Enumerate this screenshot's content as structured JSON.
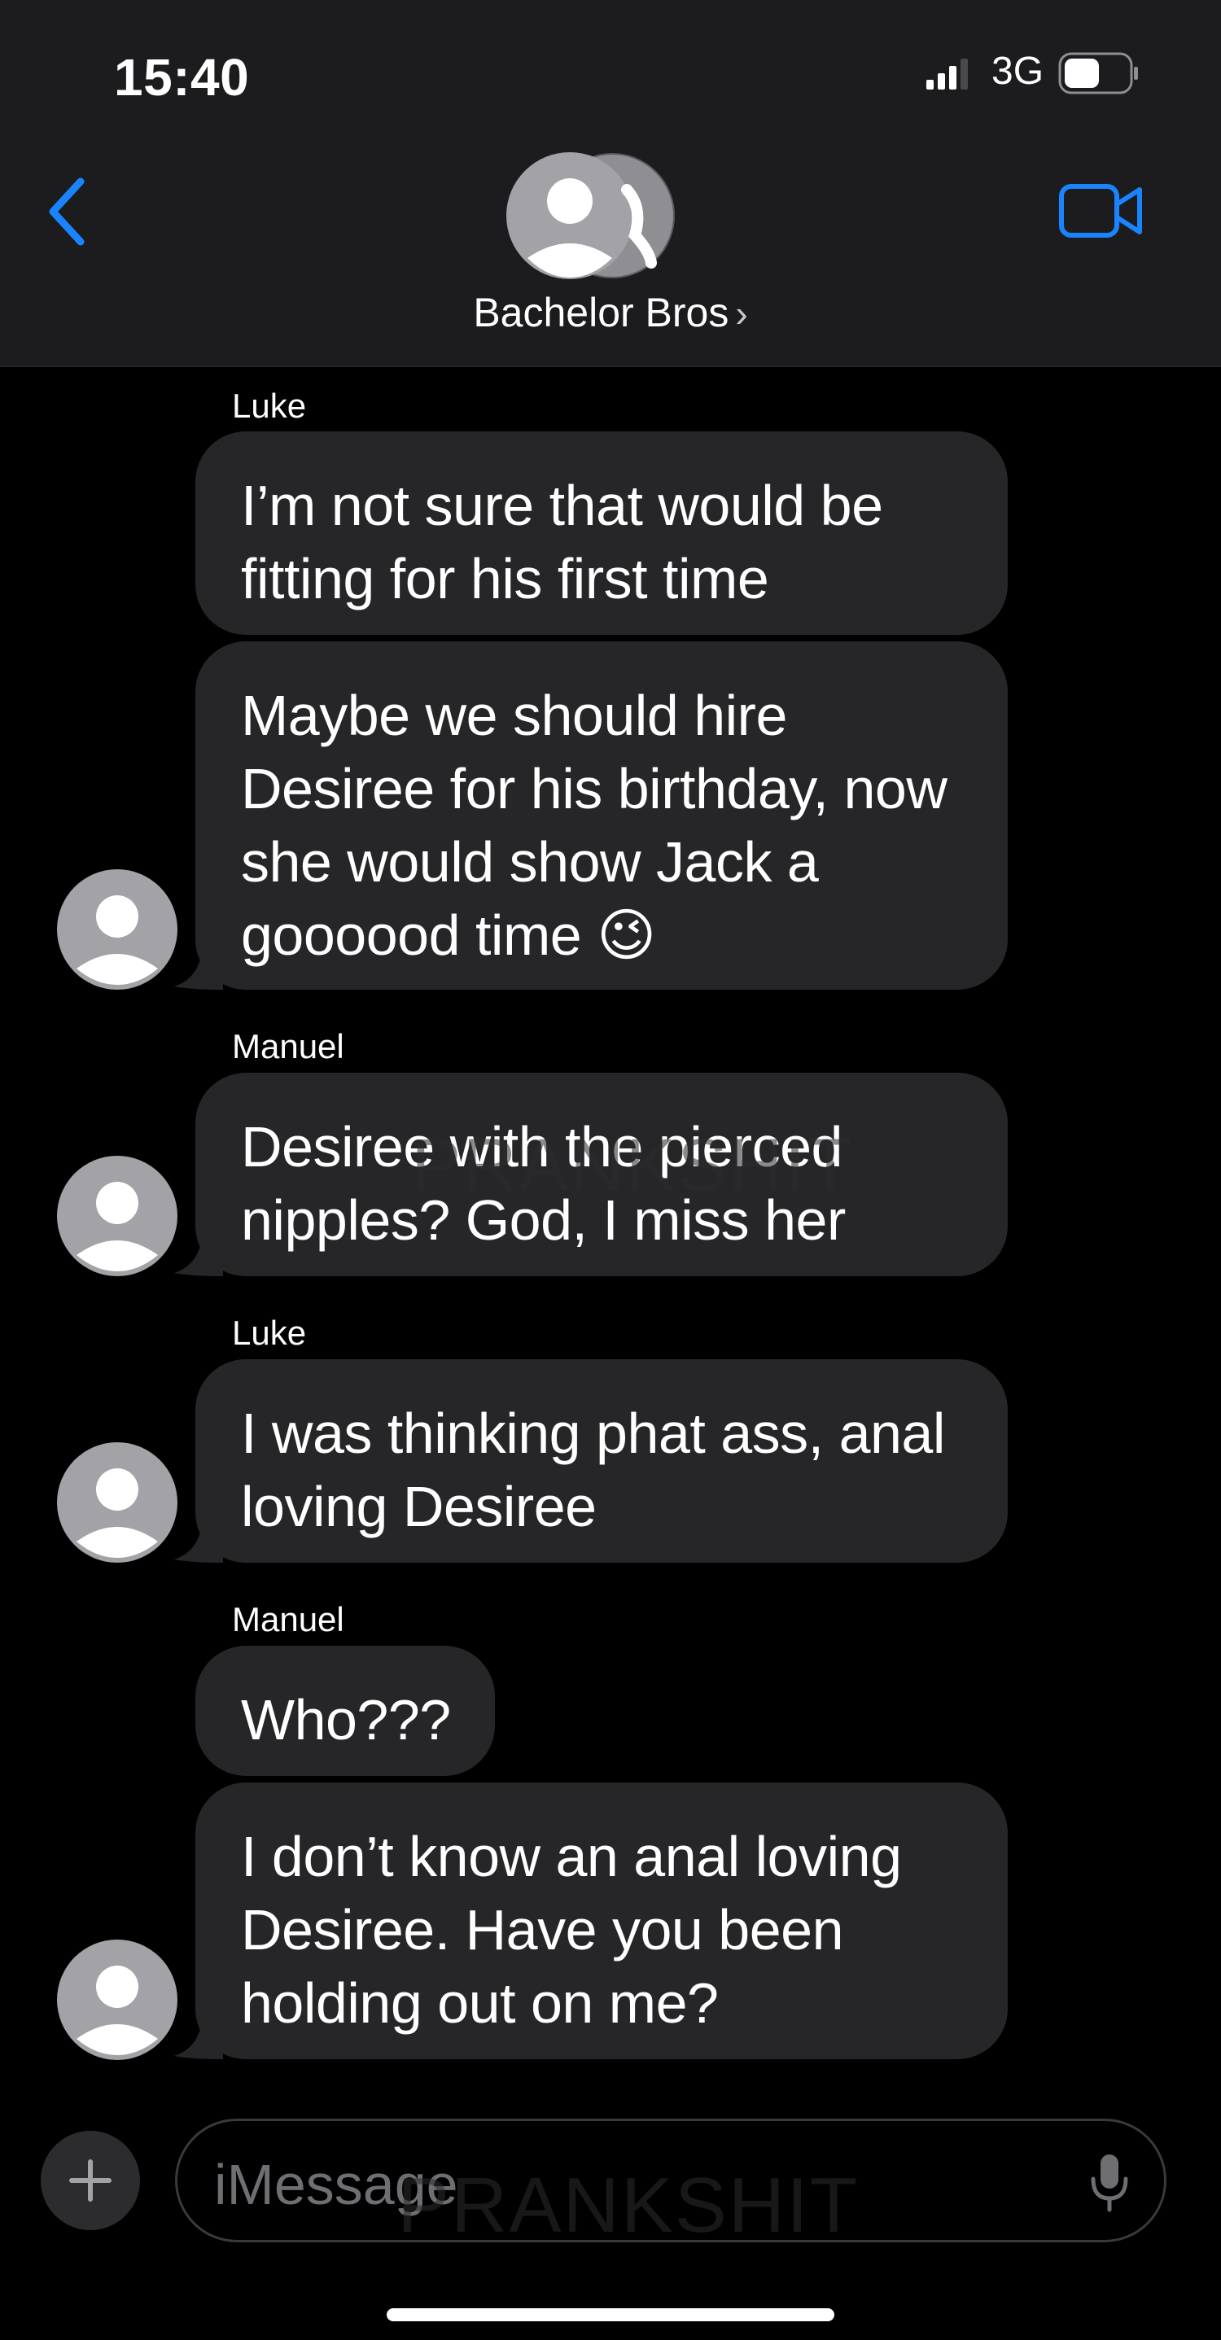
{
  "status_bar": {
    "time": "15:40",
    "network": "3G"
  },
  "header": {
    "title": "Bachelor Bros",
    "chevron": "›"
  },
  "watermark": "PRANKSHIT",
  "messages": [
    {
      "sender": "Luke",
      "text": "I’m not sure that would be fitting for his first time"
    },
    {
      "sender": "Luke",
      "text": "Maybe we should hire Desiree for his birthday, now she would show Jack a goooood time 😉"
    },
    {
      "sender": "Manuel",
      "text": "Desiree with the pierced nipples? God, I miss her"
    },
    {
      "sender": "Luke",
      "text": "I was thinking phat ass, anal loving Desiree"
    },
    {
      "sender": "Manuel",
      "text": "Who???"
    },
    {
      "sender": "Manuel",
      "text": "I don’t know an anal loving Desiree. Have you been holding out on me?"
    }
  ],
  "composer": {
    "placeholder": "iMessage"
  },
  "colors": {
    "accent": "#1a84ff",
    "header_bg": "#1c1c1e",
    "bubble_bg": "#262628",
    "background": "#000000"
  },
  "icons": {
    "back": "chevron-left-icon",
    "video": "video-camera-icon",
    "plus": "plus-icon",
    "mic": "microphone-icon",
    "avatar": "person-avatar-icon"
  }
}
